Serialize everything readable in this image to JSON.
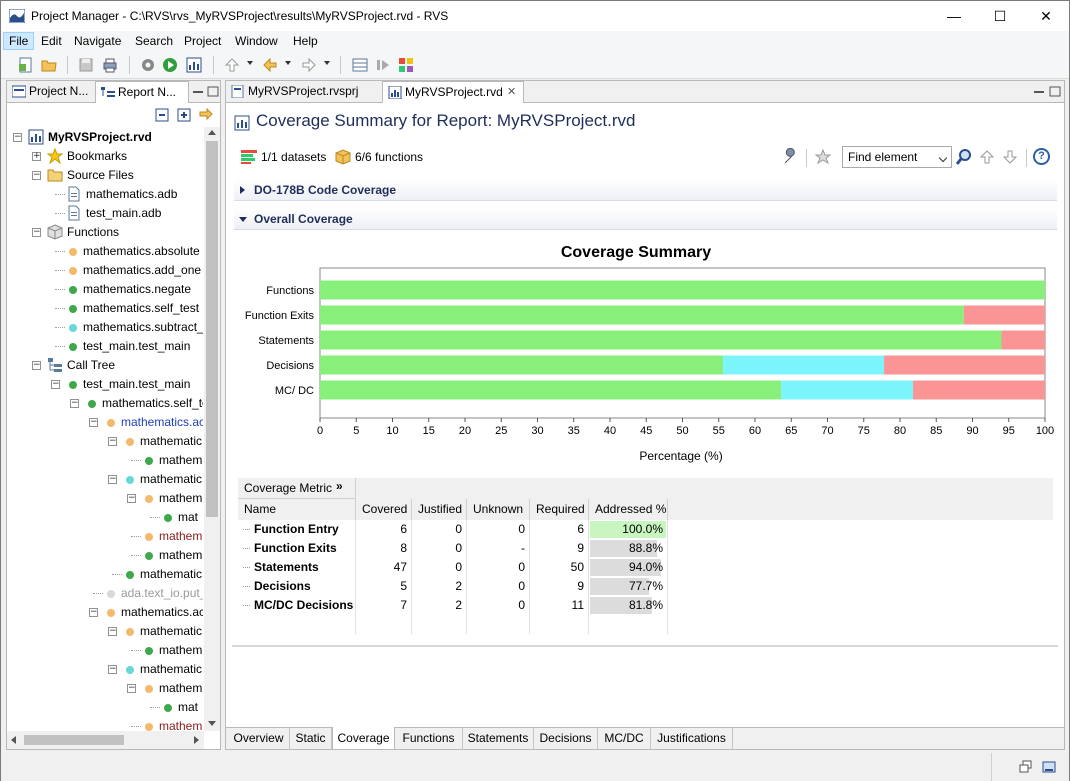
{
  "window": {
    "title": "Project Manager - C:\\RVS\\rvs_MyRVSProject\\results\\MyRVSProject.rvd - RVS",
    "minimize": "—",
    "maximize": "☐",
    "close": "✕"
  },
  "menu": [
    "File",
    "Edit",
    "Navigate",
    "Search",
    "Project",
    "Window",
    "Help"
  ],
  "left_tabs": [
    {
      "label": "Project N..."
    },
    {
      "label": "Report N..."
    }
  ],
  "tree": [
    {
      "label": "MyRVSProject.rvd",
      "bold": true
    },
    {
      "label": "Bookmarks"
    },
    {
      "label": "Source Files"
    },
    {
      "label": "mathematics.adb"
    },
    {
      "label": "test_main.adb"
    },
    {
      "label": "Functions"
    },
    {
      "label": "mathematics.absolute",
      "dot": "#f5b96a"
    },
    {
      "label": "mathematics.add_one",
      "dot": "#f5b96a"
    },
    {
      "label": "mathematics.negate",
      "dot": "#3ea84c"
    },
    {
      "label": "mathematics.self_test",
      "dot": "#3ea84c"
    },
    {
      "label": "mathematics.subtract_c",
      "dot": "#67d7d7"
    },
    {
      "label": "test_main.test_main",
      "dot": "#3ea84c"
    },
    {
      "label": "Call Tree"
    },
    {
      "label": "test_main.test_main",
      "dot": "#3ea84c"
    },
    {
      "label": "mathematics.self_te",
      "dot": "#3ea84c"
    },
    {
      "label": "mathematics.ac",
      "dot": "#f5b96a"
    },
    {
      "label": "mathematic",
      "dot": "#f5b96a"
    },
    {
      "label": "mathem",
      "dot": "#3ea84c"
    },
    {
      "label": "mathematic",
      "dot": "#67d7d7"
    },
    {
      "label": "mathem",
      "dot": "#f5b96a"
    },
    {
      "label": "mat",
      "dot": "#3ea84c"
    },
    {
      "label": "mathem",
      "dot": "#f5b96a"
    },
    {
      "label": "mathem",
      "dot": "#3ea84c"
    },
    {
      "label": "mathematic",
      "dot": "#3ea84c"
    },
    {
      "label": "ada.text_io.put_",
      "dot": "#d8d8d8"
    },
    {
      "label": "mathematics.ac",
      "dot": "#f5b96a"
    },
    {
      "label": "mathematic",
      "dot": "#f5b96a"
    },
    {
      "label": "mathem",
      "dot": "#3ea84c"
    },
    {
      "label": "mathematic",
      "dot": "#67d7d7"
    },
    {
      "label": "mathem",
      "dot": "#f5b96a"
    },
    {
      "label": "mat",
      "dot": "#3ea84c"
    },
    {
      "label": "mathem",
      "dot": "#f5b96a"
    }
  ],
  "editor_tabs": [
    {
      "label": "MyRVSProject.rvsprj"
    },
    {
      "label": "MyRVSProject.rvd",
      "close": "✕"
    }
  ],
  "report": {
    "title": "Coverage Summary for Report: MyRVSProject.rvd",
    "datasets": "1/1 datasets",
    "functions": "6/6 functions",
    "find_placeholder": "Find element",
    "help": "?",
    "sections": [
      "DO-178B Code Coverage",
      "Overall Coverage"
    ]
  },
  "chart_data": {
    "type": "bar",
    "orientation": "horizontal-stacked",
    "title": "Coverage Summary",
    "xlabel": "Percentage (%)",
    "ylabel": "",
    "xlim": [
      0,
      100
    ],
    "xticks": [
      0,
      5,
      10,
      15,
      20,
      25,
      30,
      35,
      40,
      45,
      50,
      55,
      60,
      65,
      70,
      75,
      80,
      85,
      90,
      95,
      100
    ],
    "categories": [
      "Functions",
      "Function Exits",
      "Statements",
      "Decisions",
      "MC/ DC"
    ],
    "series": [
      {
        "color": "#88f07a",
        "values": [
          100,
          88.8,
          94.0,
          55.6,
          63.6
        ]
      },
      {
        "color": "#7cf4fb",
        "values": [
          0,
          0,
          0,
          22.2,
          18.2
        ]
      },
      {
        "color": "#fb9595",
        "values": [
          0,
          11.2,
          6.0,
          22.2,
          18.2
        ]
      }
    ]
  },
  "table": {
    "header_group": "Coverage Metric",
    "header_group_icon": "»",
    "columns": [
      "Name",
      "Covered",
      "Justified",
      "Unknown",
      "Required",
      "Addressed %"
    ],
    "rows": [
      {
        "name": "Function Entry",
        "covered": "6",
        "justified": "0",
        "unknown": "0",
        "required": "6",
        "addressed": "100.0%",
        "pct": 100
      },
      {
        "name": "Function Exits",
        "covered": "8",
        "justified": "0",
        "unknown": "-",
        "required": "9",
        "addressed": "88.8%",
        "pct": 88.8
      },
      {
        "name": "Statements",
        "covered": "47",
        "justified": "0",
        "unknown": "0",
        "required": "50",
        "addressed": "94.0%",
        "pct": 94.0
      },
      {
        "name": "Decisions",
        "covered": "5",
        "justified": "2",
        "unknown": "0",
        "required": "9",
        "addressed": "77.7%",
        "pct": 77.7
      },
      {
        "name": "MC/DC Decisions",
        "covered": "7",
        "justified": "2",
        "unknown": "0",
        "required": "11",
        "addressed": "81.8%",
        "pct": 81.8
      }
    ]
  },
  "bottom_tabs": [
    "Overview",
    "Static",
    "Coverage",
    "Functions",
    "Statements",
    "Decisions",
    "MC/DC",
    "Justifications"
  ],
  "active_bottom_tab": "Coverage"
}
